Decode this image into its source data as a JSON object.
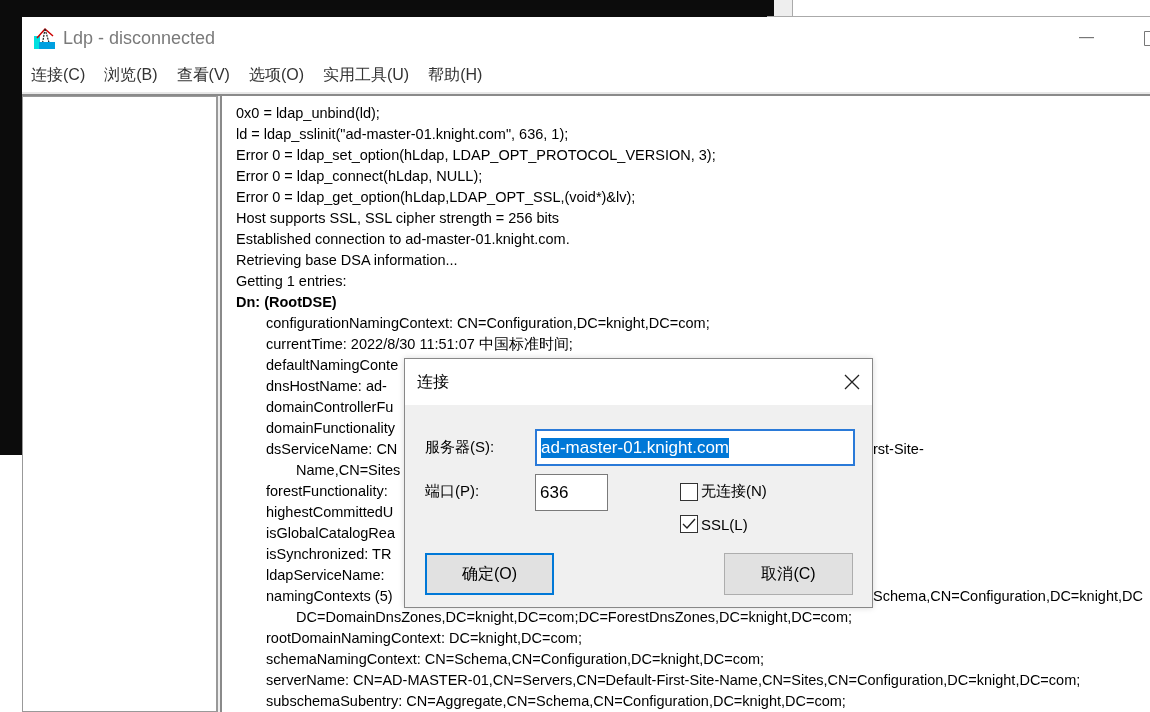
{
  "window": {
    "title": "Ldp - disconnected"
  },
  "menu": [
    "连接(C)",
    "浏览(B)",
    "查看(V)",
    "选项(O)",
    "实用工具(U)",
    "帮助(H)"
  ],
  "log": [
    {
      "kind": "plain",
      "text": "0x0 = ldap_unbind(ld);"
    },
    {
      "kind": "plain",
      "text": "ld = ldap_sslinit(\"ad-master-01.knight.com\", 636, 1);"
    },
    {
      "kind": "plain",
      "text": "Error 0 = ldap_set_option(hLdap, LDAP_OPT_PROTOCOL_VERSION, 3);"
    },
    {
      "kind": "plain",
      "text": "Error 0 = ldap_connect(hLdap, NULL);"
    },
    {
      "kind": "plain",
      "text": "Error 0 = ldap_get_option(hLdap,LDAP_OPT_SSL,(void*)&lv);"
    },
    {
      "kind": "plain",
      "text": "Host supports SSL, SSL cipher strength = 256 bits"
    },
    {
      "kind": "plain",
      "text": "Established connection to ad-master-01.knight.com."
    },
    {
      "kind": "plain",
      "text": "Retrieving base DSA information..."
    },
    {
      "kind": "plain",
      "text": "Getting 1 entries:"
    },
    {
      "kind": "heading",
      "text": "Dn: (RootDSE)"
    },
    {
      "kind": "attribute",
      "text": "configurationNamingContext: CN=Configuration,DC=knight,DC=com;"
    },
    {
      "kind": "attribute",
      "text": "currentTime: 2022/8/30 11:51:07 中国标准时间;"
    },
    {
      "kind": "attribute",
      "text": "defaultNamingConte"
    },
    {
      "kind": "attribute",
      "text": "dnsHostName: ad-"
    },
    {
      "kind": "attribute",
      "text": "domainControllerFu"
    },
    {
      "kind": "attribute",
      "text": "domainFunctionality"
    },
    {
      "kind": "attribute",
      "text": "dsServiceName: CN",
      "tail": "rst-Site-"
    },
    {
      "kind": "continuation",
      "text": "Name,CN=Sites"
    },
    {
      "kind": "attribute",
      "text": "forestFunctionality:"
    },
    {
      "kind": "attribute",
      "text": "highestCommittedU"
    },
    {
      "kind": "attribute",
      "text": "isGlobalCatalogRea"
    },
    {
      "kind": "attribute",
      "text": "isSynchronized: TR"
    },
    {
      "kind": "attribute",
      "text": "ldapServiceName:"
    },
    {
      "kind": "attribute",
      "text": "namingContexts (5)",
      "tail": "Schema,CN=Configuration,DC=knight,DC"
    },
    {
      "kind": "continuation",
      "text": "DC=DomainDnsZones,DC=knight,DC=com;DC=ForestDnsZones,DC=knight,DC=com;"
    },
    {
      "kind": "attribute",
      "text": "rootDomainNamingContext: DC=knight,DC=com;"
    },
    {
      "kind": "attribute",
      "text": "schemaNamingContext: CN=Schema,CN=Configuration,DC=knight,DC=com;"
    },
    {
      "kind": "attribute",
      "text": "serverName: CN=AD-MASTER-01,CN=Servers,CN=Default-First-Site-Name,CN=Sites,CN=Configuration,DC=knight,DC=com;"
    },
    {
      "kind": "attribute",
      "text": "subschemaSubentry: CN=Aggregate,CN=Schema,CN=Configuration,DC=knight,DC=com;"
    }
  ],
  "dialog": {
    "title": "连接",
    "server_label": "服务器(S):",
    "server_value": "ad-master-01.knight.com",
    "server_selected": true,
    "port_label": "端口(P):",
    "port_value": "636",
    "options": [
      {
        "label": "无连接(N)",
        "checked": false
      },
      {
        "label": "SSL(L)",
        "checked": true
      }
    ],
    "buttons": [
      {
        "label": "确定(O)",
        "default": true
      },
      {
        "label": "取消(C)",
        "default": false
      }
    ]
  }
}
